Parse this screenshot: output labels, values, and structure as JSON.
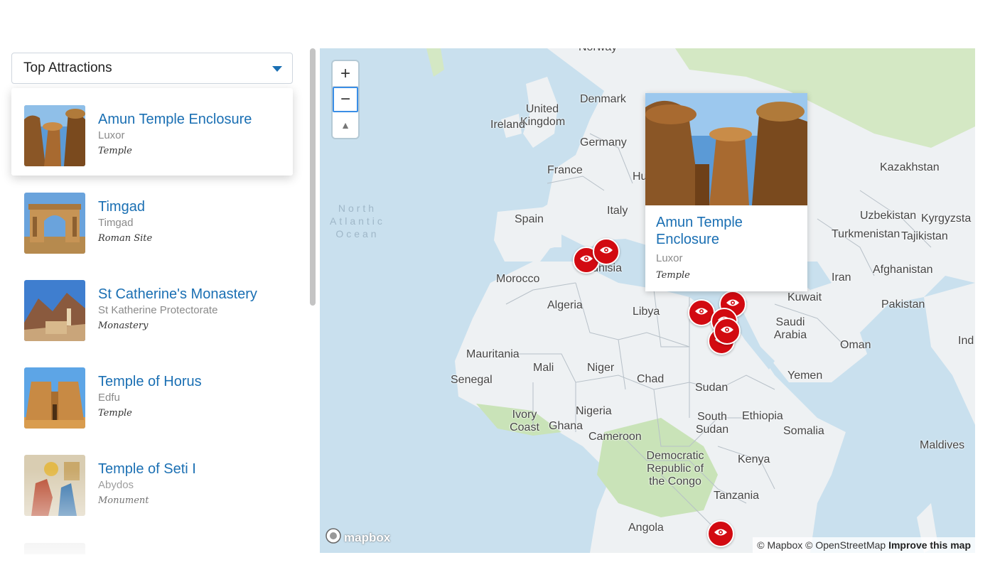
{
  "dropdown": {
    "label": "Top Attractions"
  },
  "attractions": [
    {
      "title": "Amun Temple Enclosure",
      "city": "Luxor",
      "type": "Temple"
    },
    {
      "title": "Timgad",
      "city": "Timgad",
      "type": "Roman Site"
    },
    {
      "title": "St Catherine's Monastery",
      "city": "St Katherine Protectorate",
      "type": "Monastery"
    },
    {
      "title": "Temple of Horus",
      "city": "Edfu",
      "type": "Temple"
    },
    {
      "title": "Temple of Seti I",
      "city": "Abydos",
      "type": "Monument"
    }
  ],
  "map": {
    "zoom_in": "+",
    "zoom_out": "−",
    "compass": "▲",
    "ocean": [
      "North",
      "Atlantic",
      "Ocean"
    ],
    "labels": {
      "norway": "Norway",
      "denmark": "Denmark",
      "uk": "United Kingdom",
      "ireland": "Ireland",
      "germany": "Germany",
      "france": "France",
      "hungary": "Hu",
      "spain": "Spain",
      "italy": "Italy",
      "tunisia": "Tunisia",
      "morocco": "Morocco",
      "algeria": "Algeria",
      "libya": "Libya",
      "kazakhstan": "Kazakhstan",
      "uzbekistan": "Uzbekistan",
      "kyrgyzstan": "Kyrgyzsta",
      "turkmenistan": "Turkmenistan",
      "tajikistan": "Tajikistan",
      "iran": "Iran",
      "afghanistan": "Afghanistan",
      "kuwait": "Kuwait",
      "pakistan": "Pakistan",
      "saudi": "Saudi Arabia",
      "oman": "Oman",
      "india": "Ind",
      "mauritania": "Mauritania",
      "mali": "Mali",
      "niger": "Niger",
      "chad": "Chad",
      "sudan": "Sudan",
      "senegal": "Senegal",
      "yemen": "Yemen",
      "ivory": "Ivory Coast",
      "ghana": "Ghana",
      "nigeria": "Nigeria",
      "ethiopia": "Ethiopia",
      "south_sudan": "South Sudan",
      "cameroon": "Cameroon",
      "somalia": "Somalia",
      "maldives": "Maldives",
      "drc": "Democratic Republic of the Congo",
      "kenya": "Kenya",
      "tanzania": "Tanzania",
      "angola": "Angola"
    },
    "popup": {
      "title": "Amun Temple Enclosure",
      "city": "Luxor",
      "type": "Temple"
    },
    "logo": "mapbox",
    "attribution": {
      "mapbox": "© Mapbox",
      "osm": "© OpenStreetMap",
      "improve": "Improve this map"
    }
  },
  "colors": {
    "accent": "#1a6fb3",
    "marker": "#d20a11",
    "water": "#c9e0ee",
    "land": "#eef1f3",
    "green": "#c9e3b8"
  },
  "icons": {
    "marker": "eye-icon",
    "caret": "chevron-down-icon"
  }
}
